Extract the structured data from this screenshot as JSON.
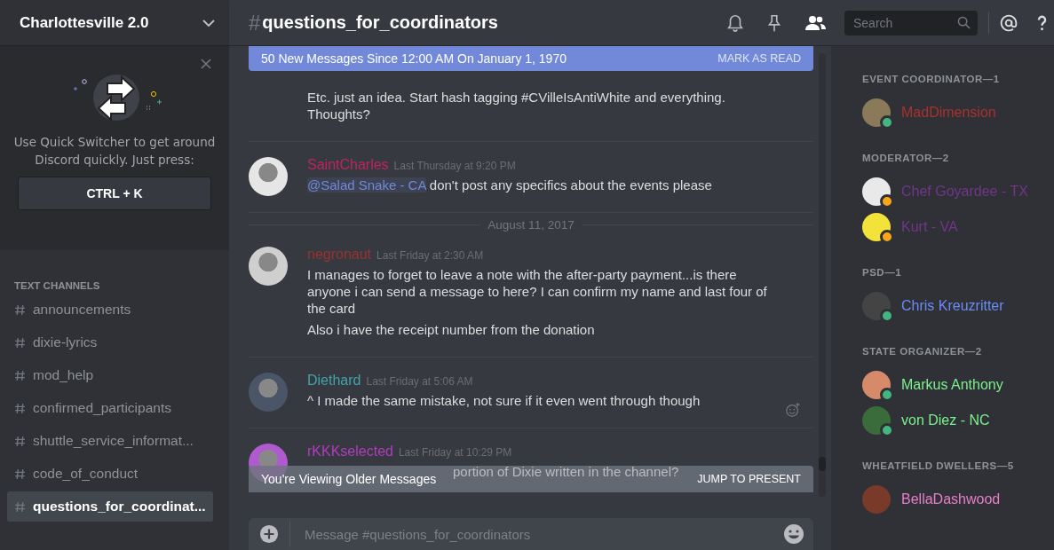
{
  "server": {
    "name": "Charlottesville 2.0"
  },
  "quick_switcher": {
    "text": "Use Quick Switcher to get around Discord quickly. Just press:",
    "shortcut": "CTRL + K"
  },
  "channel_category": "TEXT CHANNELS",
  "channels": [
    {
      "name": "announcements",
      "selected": false
    },
    {
      "name": "dixie-lyrics",
      "selected": false
    },
    {
      "name": "mod_help",
      "selected": false
    },
    {
      "name": "confirmed_participants",
      "selected": false
    },
    {
      "name": "shuttle_service_informat...",
      "selected": false
    },
    {
      "name": "code_of_conduct",
      "selected": false
    },
    {
      "name": "questions_for_coordinat...",
      "selected": true
    }
  ],
  "channel_header": {
    "hash": "#",
    "name": "questions_for_coordinators"
  },
  "search": {
    "placeholder": "Search"
  },
  "new_messages_bar": {
    "text": "50 New Messages Since 12:00 AM On January 1, 1970",
    "action": "MARK AS READ"
  },
  "messages": [
    {
      "kind": "continuation",
      "paragraphs": [
        "Etc. just an idea. Start hash tagging #CVilleIsAntiWhite and everything. Thoughts?"
      ]
    },
    {
      "kind": "message",
      "author": "SaintCharles",
      "color": "#c0245c",
      "timestamp": "Last Thursday at 9:20 PM",
      "mention": "@Salad Snake - CA",
      "paragraphs": [
        "don't post any specifics about the events please"
      ]
    },
    {
      "kind": "divider",
      "label": "August 11, 2017"
    },
    {
      "kind": "message",
      "author": "negronaut",
      "color": "#9a3232",
      "timestamp": "Last Friday at 2:30 AM",
      "paragraphs": [
        "I manages to forget to leave a note with the after-party payment...is there anyone i can send a message to here? I can confirm my name and last four of the card",
        "Also i have the receipt number from the donation"
      ]
    },
    {
      "kind": "message",
      "author": "Diethard",
      "color": "#43a3ab",
      "timestamp": "Last Friday at 5:06 AM",
      "reaction_button": true,
      "paragraphs": [
        "^ I made the same mistake, not sure if it even went through though"
      ]
    },
    {
      "kind": "message",
      "author": "rKKKselected",
      "color": "#b13cbd",
      "timestamp": "Last Friday at 10:29 PM",
      "covered": true,
      "paragraphs": [
        "portion of Dixie written in the channel?"
      ]
    }
  ],
  "older_messages_bar": {
    "text": "You're Viewing Older Messages",
    "action": "JUMP TO PRESENT"
  },
  "composer": {
    "placeholder": "Message #questions_for_coordinators"
  },
  "member_groups": [
    {
      "title": "EVENT COORDINATOR—1",
      "members": [
        {
          "name": "MadDimension",
          "color": "#a8322d",
          "status_dot": {
            "color": "#43b581"
          }
        }
      ]
    },
    {
      "title": "MODERATOR—2",
      "members": [
        {
          "name": "Chef Goyardee - TX",
          "color": "#71368a",
          "status_dot": {
            "color": "#faa61a"
          }
        },
        {
          "name": "Kurt - VA",
          "color": "#71368a",
          "status_dot": {
            "color": "#faa61a"
          }
        }
      ]
    },
    {
      "title": "PSD—1",
      "members": [
        {
          "name": "Chris Kreuzritter",
          "color": "#6a8cf5",
          "status_dot": {
            "color": "#43b581"
          }
        }
      ]
    },
    {
      "title": "STATE ORGANIZER—2",
      "members": [
        {
          "name": "Markus Anthony",
          "color": "#7bf08e",
          "status_dot": {
            "color": "#43b581"
          }
        },
        {
          "name": "von Diez - NC",
          "color": "#7bf08e",
          "status_dot": {
            "color": "#43b581"
          }
        }
      ]
    },
    {
      "title": "WHEATFIELD DWELLERS—5",
      "members": [
        {
          "name": "BellaDashwood",
          "color": "#e77fc8"
        }
      ]
    }
  ]
}
